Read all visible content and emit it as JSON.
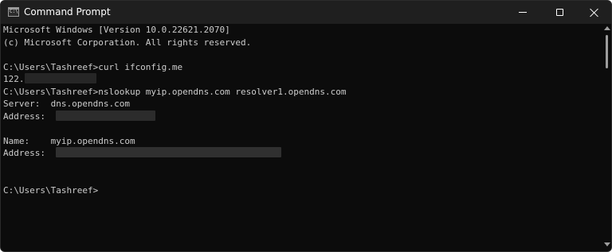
{
  "window": {
    "title": "Command Prompt",
    "app_icon": "cmd-icon",
    "buttons": [
      "minimize-icon",
      "maximize-icon",
      "close-icon"
    ]
  },
  "console": {
    "lines": [
      "Microsoft Windows [Version 10.0.22621.2070]",
      "(c) Microsoft Corporation. All rights reserved.",
      "",
      "C:\\Users\\Tashreef>curl ifconfig.me",
      "122.",
      "C:\\Users\\Tashreef>nslookup myip.opendns.com resolver1.opendns.com",
      "Server:  dns.opendns.com",
      "Address:  ",
      "",
      "Name:    myip.opendns.com",
      "Address:  ",
      "",
      "",
      "C:\\Users\\Tashreef>"
    ]
  },
  "colors": {
    "console_bg": "#0c0c0c",
    "titlebar_bg": "#1f1f1f",
    "text": "#cccccc"
  }
}
